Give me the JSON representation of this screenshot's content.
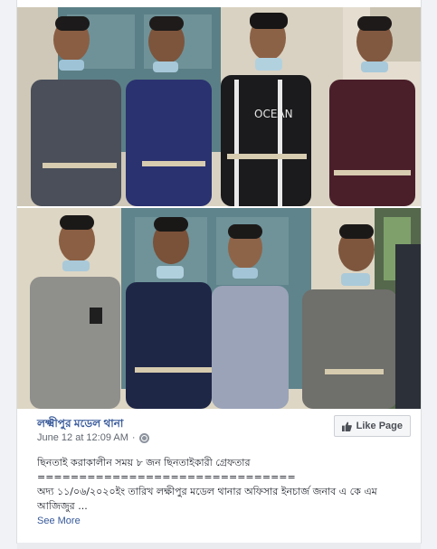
{
  "post": {
    "page_name": "লক্ষ্মীপুর মডেল থানা",
    "timestamp": "June 12 at 12:09 AM",
    "separator": "·",
    "like_button_label": "Like Page",
    "text_line_1": "ছিনতাই করাকালীন সময় ৮ জন ছিনতাইকারী গ্রেফতার",
    "text_line_2": "===============================",
    "text_line_3": "অদ্য ১১/০৬/২০২০ইং তারিখ লক্ষীপুর মডেল থানার অফিসার ইনচার্জ জনাব এ কে এম",
    "text_line_4": "আজিজুর ...",
    "see_more": "See More"
  },
  "photos": {
    "top_shirt_text": "OCEAN"
  },
  "icons": {
    "like": "thumbs-up-icon",
    "privacy": "globe-icon"
  },
  "colors": {
    "link": "#365899",
    "meta": "#616770",
    "text": "#1d2129"
  }
}
